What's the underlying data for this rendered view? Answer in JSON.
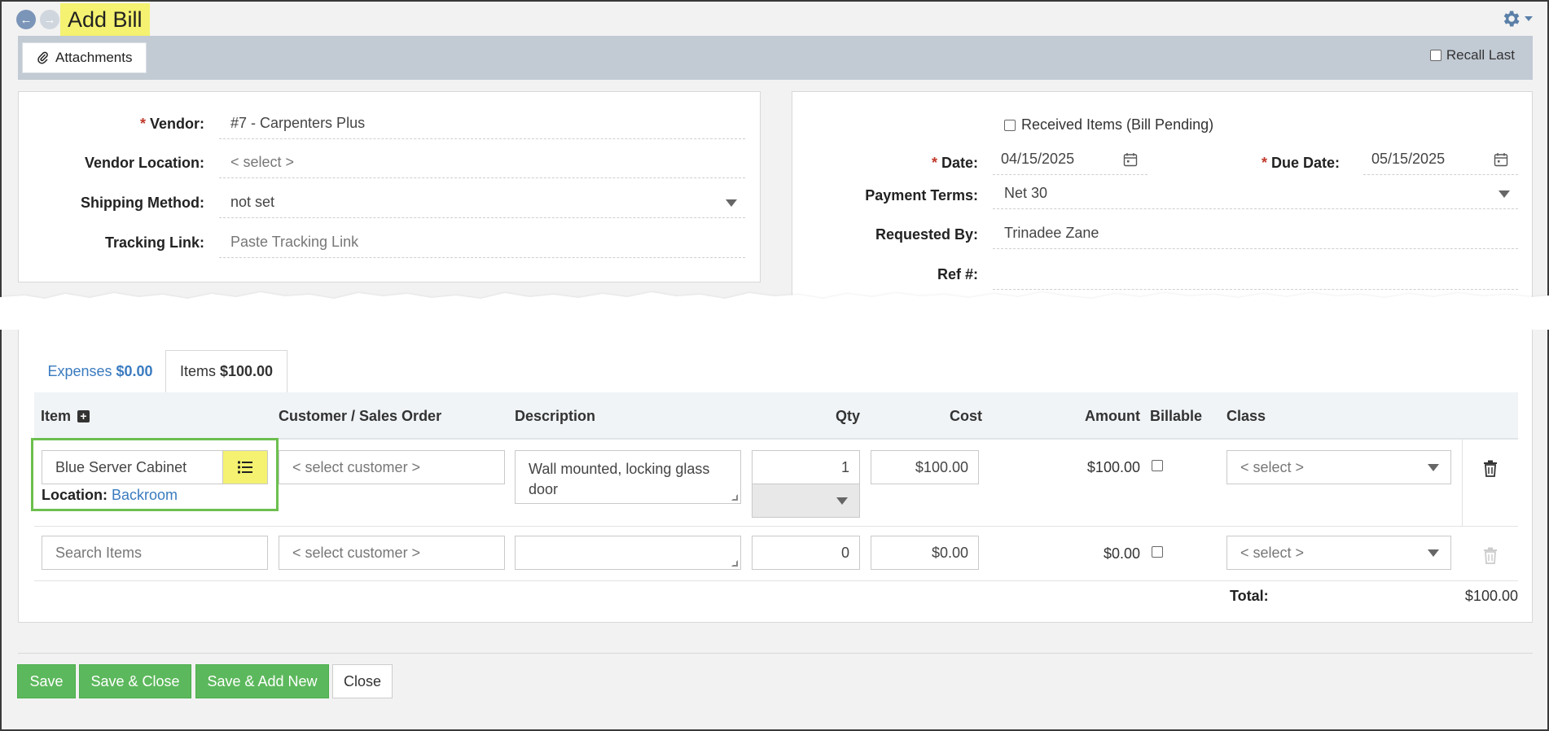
{
  "header": {
    "title": "Add Bill"
  },
  "toolbar": {
    "attachments_label": "Attachments",
    "recall_last_label": "Recall Last"
  },
  "vendor_panel": {
    "vendor_label": "Vendor:",
    "vendor_value": "#7 - Carpenters Plus",
    "vendor_location_label": "Vendor Location:",
    "vendor_location_value": "< select >",
    "shipping_method_label": "Shipping Method:",
    "shipping_method_value": "not set",
    "tracking_link_label": "Tracking Link:",
    "tracking_link_placeholder": "Paste Tracking Link"
  },
  "bill_panel": {
    "received_items_label": "Received Items (Bill Pending)",
    "date_label": "Date:",
    "date_value": "04/15/2025",
    "due_date_label": "Due Date:",
    "due_date_value": "05/15/2025",
    "payment_terms_label": "Payment Terms:",
    "payment_terms_value": "Net 30",
    "requested_by_label": "Requested By:",
    "requested_by_value": "Trinadee Zane",
    "ref_label": "Ref #:",
    "ref_value": ""
  },
  "tabs": {
    "expenses_label": "Expenses",
    "expenses_amount": "$0.00",
    "items_label": "Items",
    "items_amount": "$100.00"
  },
  "table": {
    "columns": {
      "item": "Item",
      "customer": "Customer / Sales Order",
      "description": "Description",
      "qty": "Qty",
      "cost": "Cost",
      "amount": "Amount",
      "billable": "Billable",
      "class": "Class"
    },
    "rows": [
      {
        "item": "Blue Server Cabinet",
        "location_label": "Location:",
        "location_value": "Backroom",
        "customer": "< select customer >",
        "description": "Wall mounted, locking glass door",
        "qty": "1",
        "cost": "$100.00",
        "amount": "$100.00",
        "class": "< select >"
      },
      {
        "item_placeholder": "Search Items",
        "customer": "< select customer >",
        "description": "",
        "qty": "0",
        "cost": "$0.00",
        "amount": "$0.00",
        "class": "< select >"
      }
    ],
    "total_label": "Total:",
    "total_value": "$100.00"
  },
  "footer": {
    "save": "Save",
    "save_close": "Save & Close",
    "save_add_new": "Save & Add New",
    "close": "Close"
  },
  "colors": {
    "highlight": "#f4f270",
    "green_button": "#5cb85c",
    "link_blue": "#3a7bbf",
    "required": "#c0392b",
    "selection_border": "#6cbf4e"
  }
}
